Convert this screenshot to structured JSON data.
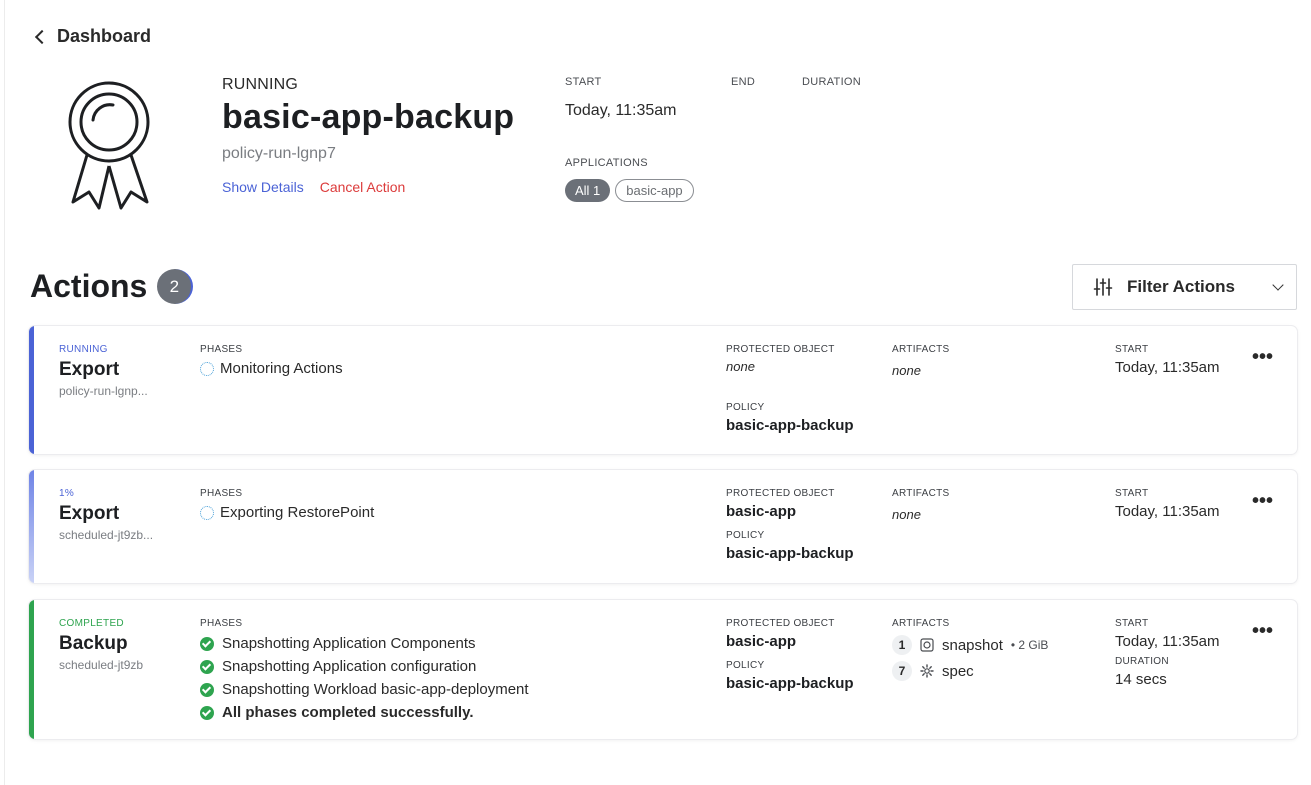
{
  "back": {
    "label": "Dashboard"
  },
  "run": {
    "status": "RUNNING",
    "name": "basic-app-backup",
    "id": "policy-run-lgnp7",
    "show_details": "Show Details",
    "cancel_action": "Cancel Action"
  },
  "meta": {
    "start_label": "START",
    "start_value": "Today, 11:35am",
    "end_label": "END",
    "duration_label": "DURATION",
    "applications_label": "APPLICATIONS",
    "chips": [
      "All 1",
      "basic-app"
    ]
  },
  "actions": {
    "title": "Actions",
    "count": "2",
    "filter_label": "Filter Actions"
  },
  "labels": {
    "phases": "PHASES",
    "protected_object": "PROTECTED OBJECT",
    "policy": "POLICY",
    "artifacts": "ARTIFACTS",
    "start": "START",
    "duration": "DURATION"
  },
  "cards": [
    {
      "status": "RUNNING",
      "status_color": "#4b63d6",
      "title": "Export",
      "sub": "policy-run-lgnp...",
      "phases": [
        "Monitoring Actions"
      ],
      "protected_object": "none",
      "policy": "basic-app-backup",
      "artifacts": "none",
      "start": "Today, 11:35am"
    },
    {
      "status": "1%",
      "status_color": "#4b63d6",
      "title": "Export",
      "sub": "scheduled-jt9zb...",
      "phases": [
        "Exporting RestorePoint"
      ],
      "protected_object": "basic-app",
      "policy": "basic-app-backup",
      "artifacts": "none",
      "start": "Today, 11:35am"
    },
    {
      "status": "COMPLETED",
      "status_color": "#2ea44f",
      "title": "Backup",
      "sub": "scheduled-jt9zb",
      "phases": [
        "Snapshotting Application Components",
        "Snapshotting Application configuration",
        "Snapshotting Workload basic-app-deployment",
        "All phases completed successfully."
      ],
      "protected_object": "basic-app",
      "policy": "basic-app-backup",
      "artifacts": [
        {
          "count": "1",
          "name": "snapshot",
          "icon": "snapshot-icon",
          "size": "• 2 GiB"
        },
        {
          "count": "7",
          "name": "spec",
          "icon": "gear-icon"
        }
      ],
      "start": "Today, 11:35am",
      "duration": "14 secs"
    }
  ],
  "colors": {
    "accent_blue": "#4b63d6",
    "success_green": "#2ea44f",
    "danger_red": "#dc3b3b"
  },
  "more_glyph": "•••"
}
